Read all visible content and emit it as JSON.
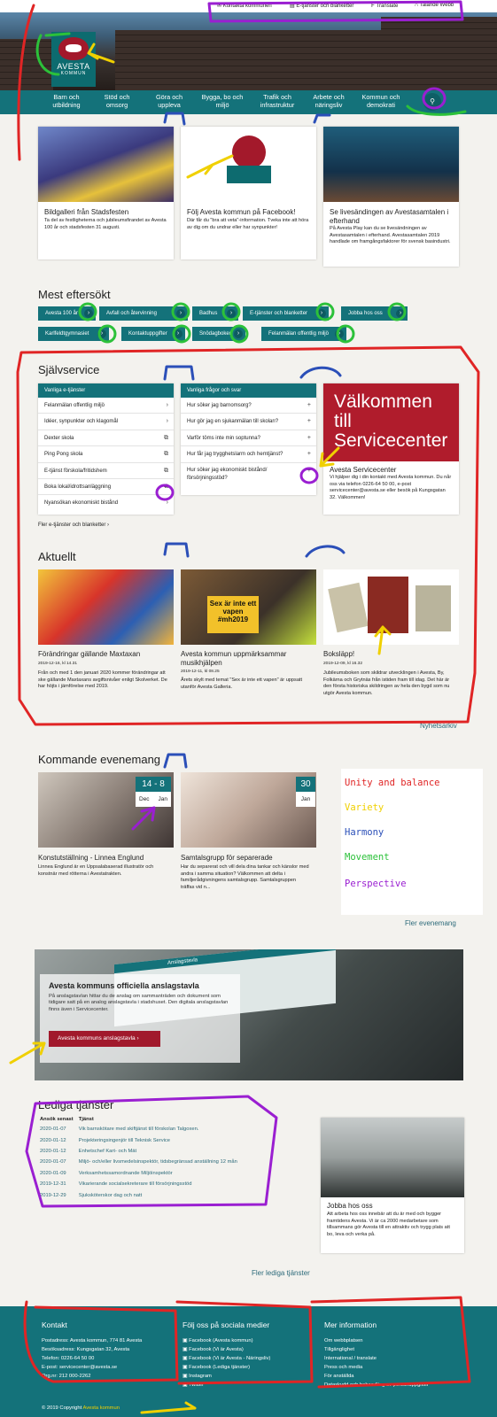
{
  "topbar": {
    "items": [
      {
        "icon": "chat-icon",
        "glyph": "✉",
        "label": "Kontakta kommunen"
      },
      {
        "icon": "document-icon",
        "glyph": "▤",
        "label": "E-tjänster och blanketter"
      },
      {
        "icon": "translate-icon",
        "glyph": "Ͱ",
        "label": "Translate"
      },
      {
        "icon": "headphones-icon",
        "glyph": "∩",
        "label": "Talande Webb"
      }
    ]
  },
  "logo": {
    "line1": "AVESTA",
    "line2": "KOMMUN"
  },
  "nav": {
    "items": [
      "Barn och utbildning",
      "Stöd och omsorg",
      "Göra och uppleva",
      "Bygga, bo och miljö",
      "Trafik och infrastruktur",
      "Arbete och näringsliv",
      "Kommun och demokrati"
    ],
    "search_icon": "search-icon"
  },
  "featured": [
    {
      "title": "Bildgalleri från Stadsfesten",
      "text": "Ta del av festligheterna och jubileumsfirandet av Avesta 100 år och stadsfesten 31 augusti."
    },
    {
      "title": "Följ Avesta kommun på Facebook!",
      "text": "Där får du \"bra att veta\"-information. Tveka inte att höra av dig om du undrar eller har synpunkter!"
    },
    {
      "title": "Se livesändingen av Avestasamtalen i efterhand",
      "text": "På Avesta Play kan du se livesändningen av Avestasamtalen i efterhand. Avestasamtalen 2019 handlade om framgångsfaktorer för svensk basindustri."
    }
  ],
  "mest_eftersokt": {
    "heading": "Mest eftersökt",
    "chips": [
      "Avesta 100 år",
      "Avfall och återvinning",
      "Badhus",
      "E-tjänster och blanketter",
      "Jobba hos oss",
      "Karlfeldtgymnasiet",
      "Kontaktuppgifter",
      "Snödagboken",
      "Felanmälan offentlig miljö"
    ]
  },
  "sjalvservice": {
    "heading": "Självservice",
    "etjanster": {
      "header": "Vanliga e-tjänster",
      "rows": [
        {
          "label": "Felanmälan offentlig miljö",
          "icon": "chevron-right-icon",
          "glyph": "›"
        },
        {
          "label": "Idéer, synpunkter och klagomål",
          "icon": "chevron-right-icon",
          "glyph": "›"
        },
        {
          "label": "Dexter skola",
          "icon": "external-link-icon",
          "glyph": "⧉"
        },
        {
          "label": "Ping Pong skola",
          "icon": "external-link-icon",
          "glyph": "⧉"
        },
        {
          "label": "E-tjänst förskola/fritidshem",
          "icon": "external-link-icon",
          "glyph": "⧉"
        },
        {
          "label": "Boka lokal/idrottsanläggning",
          "icon": "external-link-icon",
          "glyph": "⧉"
        },
        {
          "label": "Nyansökan ekonomiskt bistånd",
          "icon": "chevron-right-icon",
          "glyph": "›"
        }
      ],
      "more": "Fler e-tjänster och blanketter  ›"
    },
    "fragor": {
      "header": "Vanliga frågor och svar",
      "rows": [
        "Hur söker jag barnomsorg?",
        "Hur gör jag en sjukanmälan till skolan?",
        "Varför töms inte min soptunna?",
        "Hur får jag trygghetslarm och hemtjänst?",
        "Hur söker jag ekonomiskt bistånd/ försörjningsstöd?"
      ],
      "plus": "+"
    },
    "servicecenter": {
      "sign": "Välkommen till Servicecenter",
      "title": "Avesta Servicecenter",
      "text": "Vi hjälper dig i din kontakt med Avesta kommun. Du når oss via telefon 0226-64 50 00, e-post servicecenter@avesta.se eller besök på Kungsgatan 32. Välkommen!"
    }
  },
  "aktuellt": {
    "heading": "Aktuellt",
    "items": [
      {
        "title": "Förändringar gällande Maxtaxan",
        "date": "2019-12-16, kl 14.31",
        "text": "Från och med 1 den januari 2020 kommer förändringar att ske gällande Maxtaxans avgiftsnivåer enligt Skolverket. De har höjts i jämförelse med 2019."
      },
      {
        "title": "Avesta kommun uppmärksammar musikhjälpen",
        "date": "2019-12-11, kl 08.25",
        "text": "Årets skylt med temat \"Sex är inte ett vapen\" är uppsatt utanför Avesta Galleria."
      },
      {
        "title": "Boksläpp!",
        "date": "2019-12-09, kl 16.32",
        "text": "Jubileumsboken som skildrar utvecklingen i Avesta, By, Folkärna och Grytnäs från istiden fram till idag. Det här är den första historiska skildringen av hela den bygd som nu utgör Avesta kommun."
      }
    ],
    "sign_text": "Sex är inte ett vapen #mh2019",
    "more": "Nyhetsarkiv"
  },
  "evenemang": {
    "heading": "Kommande evenemang",
    "items": [
      {
        "day": "14 - 8",
        "month_a": "Dec",
        "month_b": "Jan",
        "title": "Konstutställning - Linnea Englund",
        "text": "Linnea Englund är en Uppsalabaserad illustratör och konstnär med rötterna i Avestatrakten."
      },
      {
        "day": "30",
        "month_a": "Jan",
        "title": "Samtalsgrupp för separerade",
        "text": "Har du separerat och vill dela dina tankar och känslor med andra i samma situation? Välkommen att delta i familjerådgivningens samtalsgrupp. Samtalsgruppen träffas vid n..."
      }
    ],
    "more": "Fler evenemang"
  },
  "legend": [
    {
      "label": "Unity and balance",
      "color": "#e02525"
    },
    {
      "label": "Variety",
      "color": "#f0d000"
    },
    {
      "label": "Harmony",
      "color": "#2b4fb8"
    },
    {
      "label": "Movement",
      "color": "#2cc13a"
    },
    {
      "label": "Perspective",
      "color": "#9a1fd1"
    }
  ],
  "anslag": {
    "screen_title": "Anslagstavla",
    "title": "Avesta kommuns officiella anslagstavla",
    "text": "På anslagstavlan hittar du de anslag om sammanträden och dokument som tidigare satt på en analog anslagstavla i stadshuset. Den digitala anslagstavlan finns även i Servicecenter.",
    "button": "Avesta kommuns anslagstavla  ›"
  },
  "lediga": {
    "heading": "Lediga tjänster",
    "col_date": "Ansök senast",
    "col_job": "Tjänst",
    "rows": [
      {
        "date": "2020-01-07",
        "job": "Vik barnskötare med skiftjänst till förskolan Talgoxen."
      },
      {
        "date": "2020-01-12",
        "job": "Projekteringsingenjör till Teknisk Service"
      },
      {
        "date": "2020-01-12",
        "job": "Enhetschef Kart- och Mät"
      },
      {
        "date": "2020-01-07",
        "job": "Miljö- och/eller livsmedelsinspektör, tidsbegränsad anställning 12 mån"
      },
      {
        "date": "2020-01-09",
        "job": "Verksamhetssamordnande Miljöinspektör"
      },
      {
        "date": "2019-12-31",
        "job": "Vikarierande socialsekreterare till försörjningsstöd"
      },
      {
        "date": "2019-12-29",
        "job": "Sjuksköterskor dag och natt"
      }
    ],
    "jobba_title": "Jobba hos oss",
    "jobba_text": "Att arbeta hos oss innebär att du är med och bygger framtidens Avesta. Vi är ca 2000 medarbetare som tillsammans gör Avesta till en attraktiv och trygg plats att bo, leva och verka på.",
    "more": "Fler lediga tjänster"
  },
  "footer": {
    "kontakt": {
      "heading": "Kontakt",
      "lines": [
        "Postadress: Avesta kommun, 774 81 Avesta",
        "Besöksadress: Kungsgatan 32, Avesta",
        "Telefon: 0226-64 50 00",
        "E-post: servicecenter@avesta.se",
        "Org.nr: 212 000-2262"
      ]
    },
    "social": {
      "heading": "Följ oss på sociala medier",
      "lines": [
        "Facebook (Avesta kommun)",
        "Facebook (Vi är Avesta)",
        "Facebook (Vi är Avesta - Näringsliv)",
        "Facebook (Lediga tjänster)",
        "Instagram",
        "Twitter"
      ]
    },
    "mer": {
      "heading": "Mer information",
      "lines": [
        "Om webbplatsen",
        "Tillgänglighet",
        "International / translate",
        "Press och media",
        "För anställda",
        "Dataskydd och behandling av personuppgifter"
      ]
    },
    "copyright": "© 2019 Copyright",
    "copyright_link": "Avesta kommun"
  },
  "colors": {
    "nav": "#14727a",
    "brand_red": "#a3192b",
    "link": "#2c6a7a"
  }
}
